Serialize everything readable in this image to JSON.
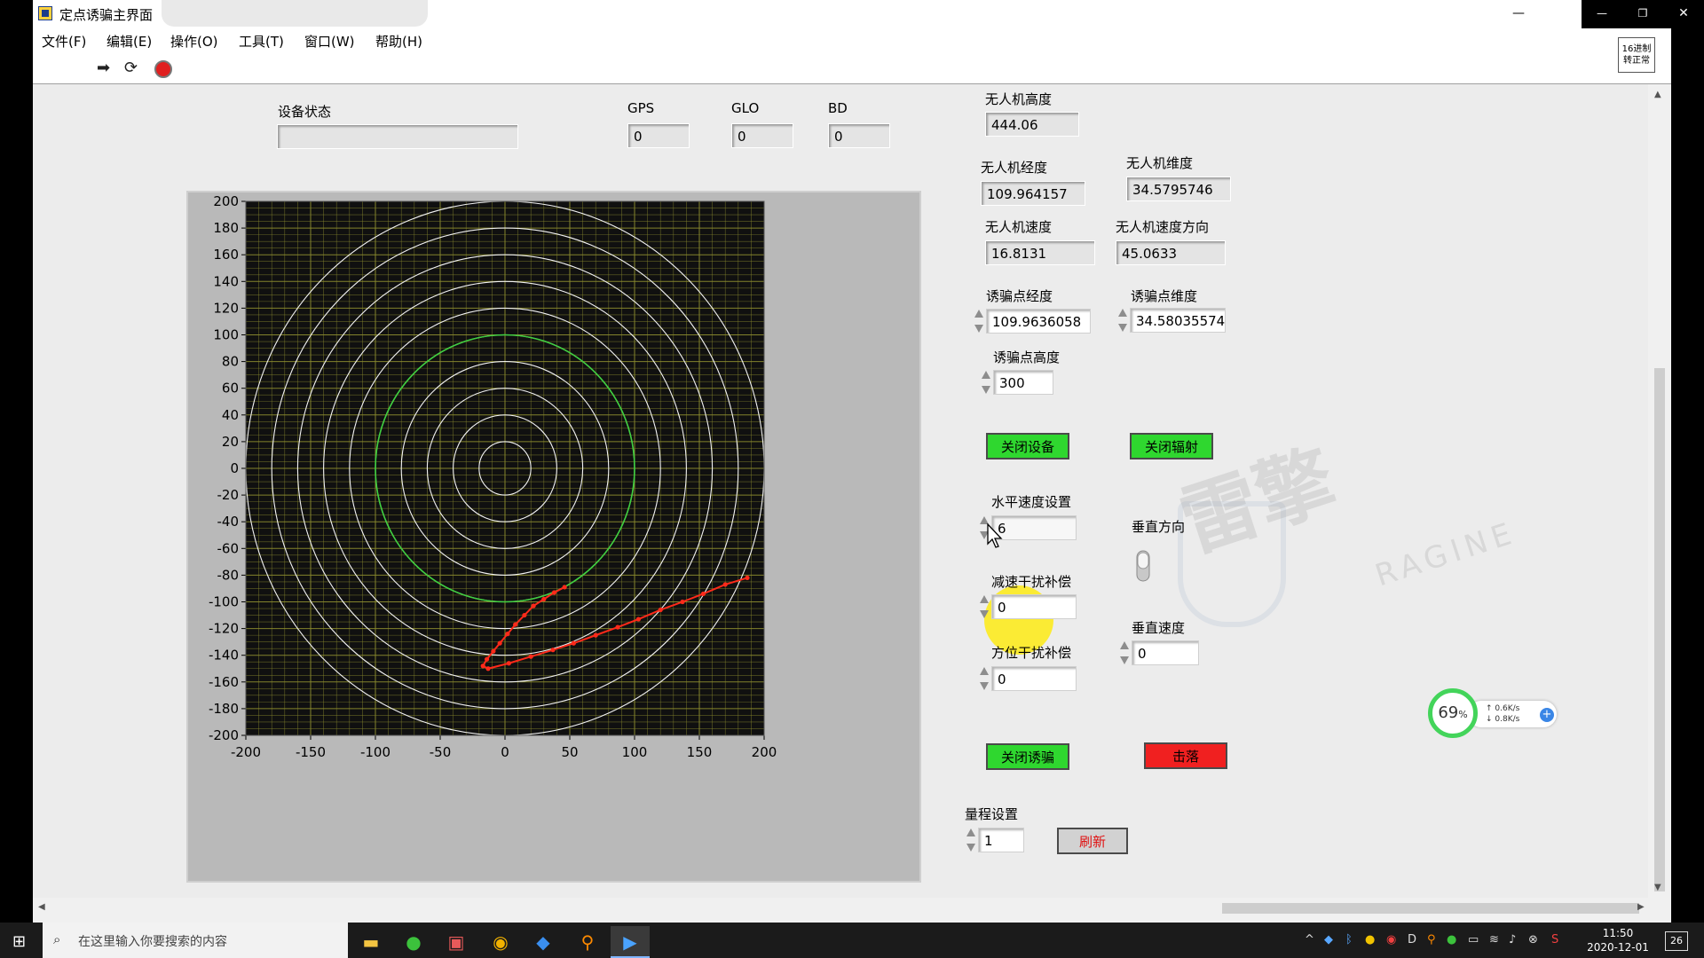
{
  "window": {
    "title": "定点诱骗主界面",
    "controls": {
      "minimize": "—",
      "restore": "❐",
      "close": "✕"
    }
  },
  "menu": [
    "文件(F)",
    "编辑(E)",
    "操作(O)",
    "工具(T)",
    "窗口(W)",
    "帮助(H)"
  ],
  "toolbar": {
    "icons": [
      "run-arrow-icon",
      "run-continuous-icon",
      "abort-stop-icon"
    ],
    "context_help": [
      "16进制",
      "转正常"
    ]
  },
  "device": {
    "status_label": "设备状态",
    "status_value": "",
    "gps_label": "GPS",
    "gps_value": "0",
    "glo_label": "GLO",
    "glo_value": "0",
    "bd_label": "BD",
    "bd_value": "0"
  },
  "uav": {
    "alt_label": "无人机高度",
    "alt_value": "444.06",
    "lon_label": "无人机经度",
    "lon_value": "109.964157",
    "lat_label": "无人机维度",
    "lat_value": "34.5795746",
    "speed_label": "无人机速度",
    "speed_value": "16.8131",
    "heading_label": "无人机速度方向",
    "heading_value": "45.0633"
  },
  "decoy": {
    "lon_label": "诱骗点经度",
    "lon_value": "109.9636058",
    "lat_label": "诱骗点维度",
    "lat_value": "34.58035574",
    "alt_label": "诱骗点高度",
    "alt_value": "300"
  },
  "buttons": {
    "close_device": "关闭设备",
    "close_radiation": "关闭辐射",
    "close_decoy": "关闭诱骗",
    "shoot_down": "击落",
    "refresh": "刷新"
  },
  "settings": {
    "h_speed_label": "水平速度设置",
    "h_speed_value": "6",
    "v_dir_label": "垂直方向",
    "decel_label": "减速干扰补偿",
    "decel_value": "0",
    "v_speed_label": "垂直速度",
    "v_speed_value": "0",
    "azimuth_label": "方位干扰补偿",
    "azimuth_value": "0",
    "range_label": "量程设置",
    "range_value": "1"
  },
  "watermark": {
    "cn": "雷擎",
    "en": "RAGINE"
  },
  "net_widget": {
    "percent": "69",
    "unit": "%",
    "up": "0.6K/s",
    "down": "0.8K/s"
  },
  "chart_data": {
    "type": "scatter",
    "xlim": [
      -200,
      200
    ],
    "ylim": [
      -200,
      200
    ],
    "x_ticks": [
      -200,
      -150,
      -100,
      -50,
      0,
      50,
      100,
      150,
      200
    ],
    "y_ticks": [
      200,
      180,
      160,
      140,
      120,
      100,
      80,
      60,
      40,
      20,
      0,
      -20,
      -40,
      -60,
      -80,
      -100,
      -120,
      -140,
      -160,
      -180,
      -200
    ],
    "grid": true,
    "range_rings": [
      20,
      40,
      60,
      80,
      100,
      120,
      140,
      160,
      180,
      200
    ],
    "highlight_ring": {
      "radius": 100,
      "color": "#40d040"
    },
    "ring_color": "#f2f2f2",
    "background": "#101010",
    "grid_color": "#8a8a2e",
    "track": {
      "color": "#ff2a1a",
      "points": [
        [
          187,
          -82
        ],
        [
          170,
          -87
        ],
        [
          153,
          -94
        ],
        [
          137,
          -100
        ],
        [
          120,
          -106
        ],
        [
          103,
          -113
        ],
        [
          87,
          -119
        ],
        [
          70,
          -125
        ],
        [
          53,
          -131
        ],
        [
          37,
          -136
        ],
        [
          20,
          -141
        ],
        [
          3,
          -146
        ],
        [
          -13,
          -150
        ],
        [
          -17,
          -148
        ],
        [
          -14,
          -143
        ],
        [
          -9,
          -137
        ],
        [
          -4,
          -131
        ],
        [
          2,
          -124
        ],
        [
          8,
          -117
        ],
        [
          15,
          -110
        ],
        [
          22,
          -103
        ],
        [
          30,
          -98
        ],
        [
          38,
          -93
        ],
        [
          46,
          -89
        ]
      ]
    }
  },
  "taskbar": {
    "search_placeholder": "在这里输入你要搜索的内容",
    "time": "11:50",
    "date": "2020-12-01",
    "notifications": "26"
  }
}
